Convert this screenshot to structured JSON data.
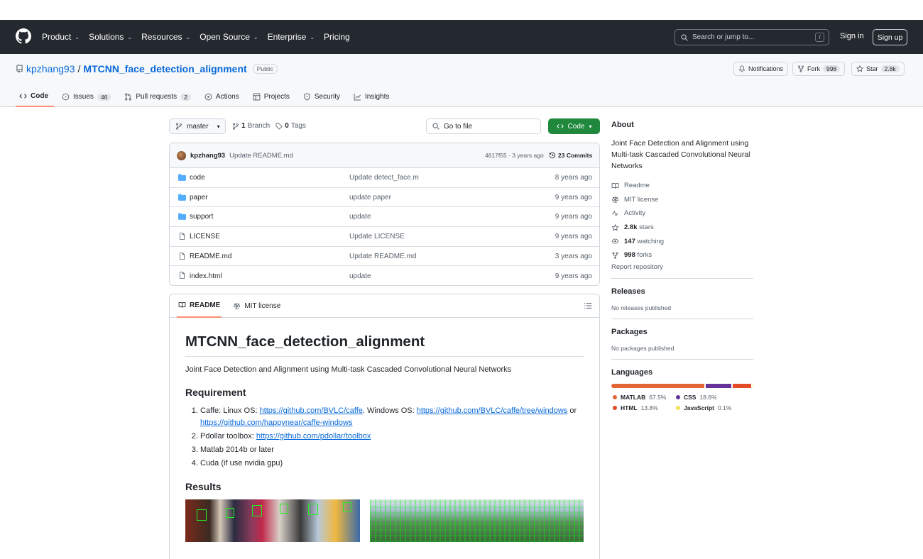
{
  "header": {
    "nav": [
      {
        "label": "Product",
        "caret": true
      },
      {
        "label": "Solutions",
        "caret": true
      },
      {
        "label": "Resources",
        "caret": true
      },
      {
        "label": "Open Source",
        "caret": true
      },
      {
        "label": "Enterprise",
        "caret": true
      },
      {
        "label": "Pricing",
        "caret": false
      }
    ],
    "search_placeholder": "Search or jump to...",
    "search_key": "/",
    "signin": "Sign in",
    "signup": "Sign up"
  },
  "repo": {
    "owner": "kpzhang93",
    "separator": "/",
    "name": "MTCNN_face_detection_alignment",
    "visibility": "Public",
    "notifications": "Notifications",
    "fork_label": "Fork",
    "fork_count": "998",
    "star_label": "Star",
    "star_count": "2.8k"
  },
  "tabs": [
    {
      "label": "Code",
      "count": "",
      "icon": "code-icon"
    },
    {
      "label": "Issues",
      "count": "46",
      "icon": "issue-icon"
    },
    {
      "label": "Pull requests",
      "count": "2",
      "icon": "pull-request-icon"
    },
    {
      "label": "Actions",
      "count": "",
      "icon": "play-icon"
    },
    {
      "label": "Projects",
      "count": "",
      "icon": "table-icon"
    },
    {
      "label": "Security",
      "count": "",
      "icon": "shield-icon"
    },
    {
      "label": "Insights",
      "count": "",
      "icon": "graph-icon"
    }
  ],
  "toolbar": {
    "branch": "master",
    "branch_count": "1",
    "branch_word": "Branch",
    "tag_count": "0",
    "tag_word": "Tags",
    "go_to_file": "Go to file",
    "code_button": "Code"
  },
  "latest_commit": {
    "author": "kpzhang93",
    "message": "Update README.md",
    "meta": "4617f55 · 3 years ago",
    "commits": "23 Commits"
  },
  "files": [
    {
      "type": "dir",
      "name": "code",
      "message": "Update detect_face.m",
      "date": "8 years ago"
    },
    {
      "type": "dir",
      "name": "paper",
      "message": "update paper",
      "date": "9 years ago"
    },
    {
      "type": "dir",
      "name": "support",
      "message": "update",
      "date": "9 years ago"
    },
    {
      "type": "file",
      "name": "LICENSE",
      "message": "Update LICENSE",
      "date": "9 years ago"
    },
    {
      "type": "file",
      "name": "README.md",
      "message": "Update README.md",
      "date": "3 years ago"
    },
    {
      "type": "file",
      "name": "index.html",
      "message": "update",
      "date": "9 years ago"
    }
  ],
  "readme": {
    "tab_readme": "README",
    "tab_license": "MIT license",
    "title": "MTCNN_face_detection_alignment",
    "description": "Joint Face Detection and Alignment using Multi-task Cascaded Convolutional Neural Networks",
    "requirement_heading": "Requirement",
    "req1_prefix": "Caffe: Linux OS: ",
    "req1_link1": "https://github.com/BVLC/caffe",
    "req1_mid": ". Windows OS: ",
    "req1_link2": "https://github.com/BVLC/caffe/tree/windows",
    "req1_or": " or",
    "req1_link3": "https://github.com/happynear/caffe-windows",
    "req2_prefix": "Pdollar toolbox: ",
    "req2_link": "https://github.com/pdollar/toolbox",
    "req3": "Matlab 2014b or later",
    "req4": "Cuda (if use nvidia gpu)",
    "results_heading": "Results"
  },
  "sidebar": {
    "about_heading": "About",
    "about_text": "Joint Face Detection and Alignment using Multi-task Cascaded Convolutional Neural Networks",
    "readme": "Readme",
    "license": "MIT license",
    "activity": "Activity",
    "stars_count": "2.8k",
    "stars_word": "stars",
    "watching_count": "147",
    "watching_word": "watching",
    "forks_count": "998",
    "forks_word": "forks",
    "report": "Report repository",
    "releases_heading": "Releases",
    "releases_none": "No releases published",
    "packages_heading": "Packages",
    "packages_none": "No packages published",
    "languages_heading": "Languages",
    "languages": [
      {
        "name": "MATLAB",
        "percent": "67.5%",
        "value": 67.5,
        "color": "#e16737"
      },
      {
        "name": "CSS",
        "percent": "18.6%",
        "value": 18.6,
        "color": "#663399"
      },
      {
        "name": "HTML",
        "percent": "13.8%",
        "value": 13.8,
        "color": "#e34c26"
      },
      {
        "name": "JavaScript",
        "percent": "0.1%",
        "value": 0.1,
        "color": "#f1e05a"
      }
    ]
  }
}
